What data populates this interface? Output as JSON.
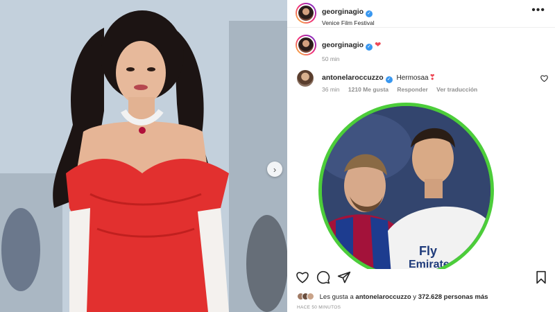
{
  "post": {
    "username": "georginagio",
    "location": "Venice Film Festival",
    "caption_time": "50 min",
    "caption_emoji": "❤",
    "more_icon": "more-horizontal-icon"
  },
  "comment": {
    "username": "antonelaroccuzzo",
    "text": "Hermosaa",
    "emoji": "❣",
    "time": "36 min",
    "likes": "1210 Me gusta",
    "reply": "Responder",
    "translate": "Ver traducción"
  },
  "likes": {
    "prefix": "Les gusta a",
    "user": "antonelaroccuzzo",
    "middle": "y",
    "count": "372.628 personas más"
  },
  "timestamp": "HACE 50 MINUTOS",
  "colors": {
    "verified": "#3897f0",
    "heart": "#ed4956",
    "circle_border": "#4ccd3a",
    "dress": "#e2302f"
  },
  "icons": [
    "heart-outline-icon",
    "comment-icon",
    "share-icon",
    "bookmark-icon",
    "verified-badge-icon",
    "chevron-right-icon"
  ]
}
